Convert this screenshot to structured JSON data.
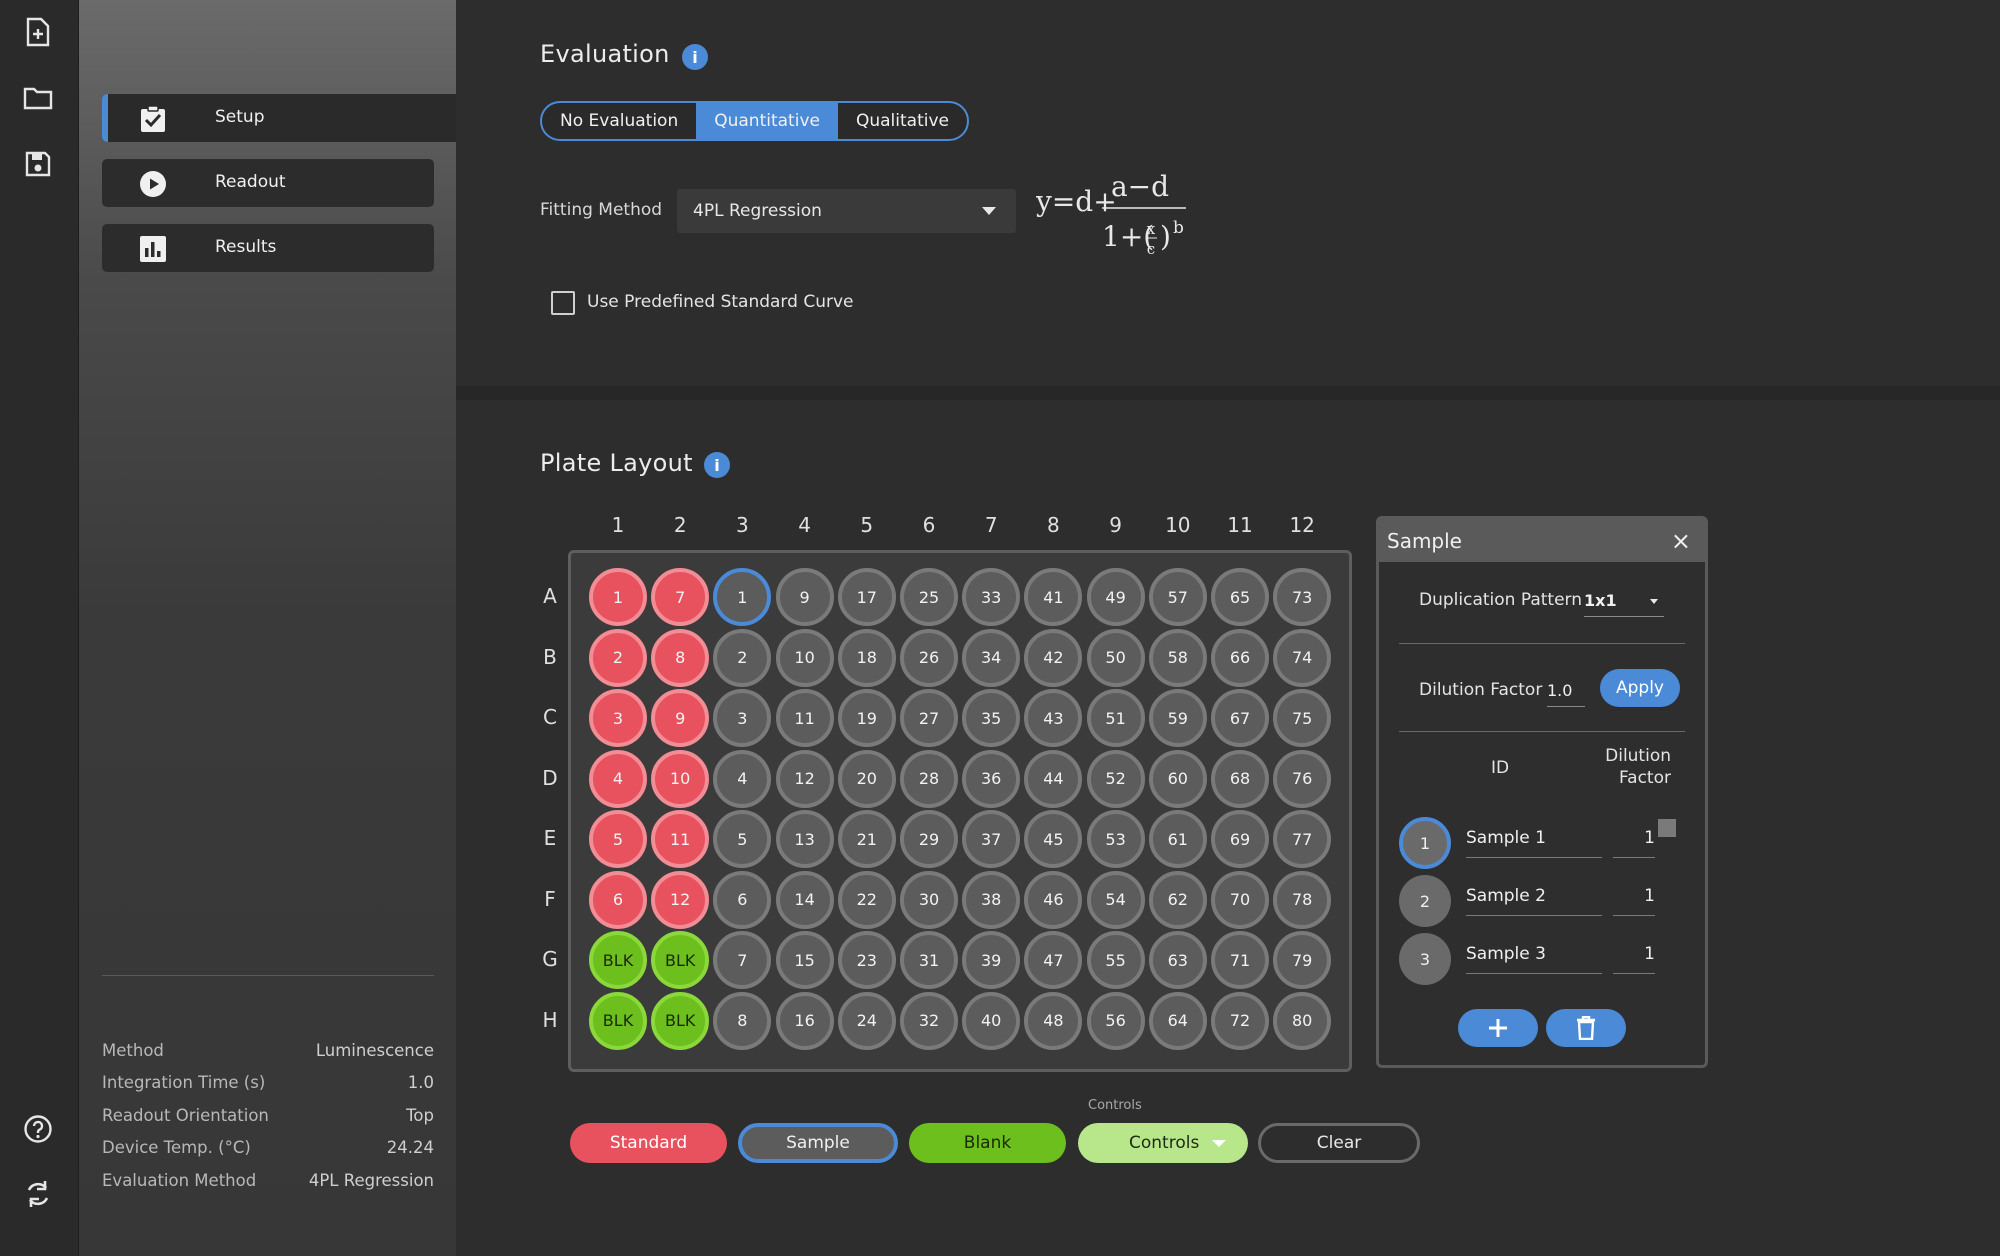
{
  "nav": {
    "items": [
      {
        "label": "Setup",
        "icon": "clipboard-check-icon"
      },
      {
        "label": "Readout",
        "icon": "play-circle-icon"
      },
      {
        "label": "Results",
        "icon": "bar-chart-icon"
      }
    ],
    "info": [
      {
        "label": "Method",
        "value": "Luminescence"
      },
      {
        "label": "Integration Time (s)",
        "value": "1.0"
      },
      {
        "label": "Readout Orientation",
        "value": "Top"
      },
      {
        "label": "Device Temp. (°C)",
        "value": "24.24"
      },
      {
        "label": "Evaluation Method",
        "value": "4PL Regression"
      }
    ]
  },
  "rail": {
    "icons": [
      "new-file-icon",
      "folder-icon",
      "save-icon",
      "help-icon",
      "refresh-icon"
    ]
  },
  "evaluation": {
    "title": "Evaluation",
    "info": "i",
    "options": [
      "No Evaluation",
      "Quantitative",
      "Qualitative"
    ],
    "selected": "Quantitative",
    "fitting_label": "Fitting Method",
    "fitting_value": "4PL Regression",
    "formula": {
      "lhs": "y=d+",
      "num": "a−d",
      "den_a": "1+(",
      "frac_x": "x",
      "frac_c": "c",
      "den_b": ")",
      "exp": "b"
    },
    "checkbox_label": "Use Predefined Standard Curve",
    "checkbox_checked": false
  },
  "plate": {
    "title": "Plate Layout",
    "info": "i",
    "columns": [
      "1",
      "2",
      "3",
      "4",
      "5",
      "6",
      "7",
      "8",
      "9",
      "10",
      "11",
      "12"
    ],
    "rows": [
      "A",
      "B",
      "C",
      "D",
      "E",
      "F",
      "G",
      "H"
    ],
    "wells": [
      [
        "1",
        "7",
        "1",
        "9",
        "17",
        "25",
        "33",
        "41",
        "49",
        "57",
        "65",
        "73"
      ],
      [
        "2",
        "8",
        "2",
        "10",
        "18",
        "26",
        "34",
        "42",
        "50",
        "58",
        "66",
        "74"
      ],
      [
        "3",
        "9",
        "3",
        "11",
        "19",
        "27",
        "35",
        "43",
        "51",
        "59",
        "67",
        "75"
      ],
      [
        "4",
        "10",
        "4",
        "12",
        "20",
        "28",
        "36",
        "44",
        "52",
        "60",
        "68",
        "76"
      ],
      [
        "5",
        "11",
        "5",
        "13",
        "21",
        "29",
        "37",
        "45",
        "53",
        "61",
        "69",
        "77"
      ],
      [
        "6",
        "12",
        "6",
        "14",
        "22",
        "30",
        "38",
        "46",
        "54",
        "62",
        "70",
        "78"
      ],
      [
        "BLK",
        "BLK",
        "7",
        "15",
        "23",
        "31",
        "39",
        "47",
        "55",
        "63",
        "71",
        "79"
      ],
      [
        "BLK",
        "BLK",
        "8",
        "16",
        "24",
        "32",
        "40",
        "48",
        "56",
        "64",
        "72",
        "80"
      ]
    ],
    "well_types": [
      [
        "std",
        "std",
        "sel",
        "smp",
        "smp",
        "smp",
        "smp",
        "smp",
        "smp",
        "smp",
        "smp",
        "smp"
      ],
      [
        "std",
        "std",
        "smp",
        "smp",
        "smp",
        "smp",
        "smp",
        "smp",
        "smp",
        "smp",
        "smp",
        "smp"
      ],
      [
        "std",
        "std",
        "smp",
        "smp",
        "smp",
        "smp",
        "smp",
        "smp",
        "smp",
        "smp",
        "smp",
        "smp"
      ],
      [
        "std",
        "std",
        "smp",
        "smp",
        "smp",
        "smp",
        "smp",
        "smp",
        "smp",
        "smp",
        "smp",
        "smp"
      ],
      [
        "std",
        "std",
        "smp",
        "smp",
        "smp",
        "smp",
        "smp",
        "smp",
        "smp",
        "smp",
        "smp",
        "smp"
      ],
      [
        "std",
        "std",
        "smp",
        "smp",
        "smp",
        "smp",
        "smp",
        "smp",
        "smp",
        "smp",
        "smp",
        "smp"
      ],
      [
        "blk",
        "blk",
        "smp",
        "smp",
        "smp",
        "smp",
        "smp",
        "smp",
        "smp",
        "smp",
        "smp",
        "smp"
      ],
      [
        "blk",
        "blk",
        "smp",
        "smp",
        "smp",
        "smp",
        "smp",
        "smp",
        "smp",
        "smp",
        "smp",
        "smp"
      ]
    ]
  },
  "sample_panel": {
    "title": "Sample",
    "close": "×",
    "duplication_label": "Duplication Pattern",
    "duplication_value": "1x1",
    "dilution_label": "Dilution Factor",
    "dilution_value": "1.0",
    "apply_label": "Apply",
    "col_id": "ID",
    "col_dilution_1": "Dilution",
    "col_dilution_2": "Factor",
    "samples": [
      {
        "num": "1",
        "name": "Sample 1",
        "dilution": "1"
      },
      {
        "num": "2",
        "name": "Sample 2",
        "dilution": "1"
      },
      {
        "num": "3",
        "name": "Sample 3",
        "dilution": "1"
      }
    ]
  },
  "bottom": {
    "controls_caption": "Controls",
    "standard": "Standard",
    "sample": "Sample",
    "blank": "Blank",
    "controls": "Controls",
    "clear": "Clear"
  },
  "colors": {
    "accent": "#4a8ad6",
    "standard": "#e8525e",
    "blank": "#6cbf1c",
    "controls": "#b8e68a"
  }
}
